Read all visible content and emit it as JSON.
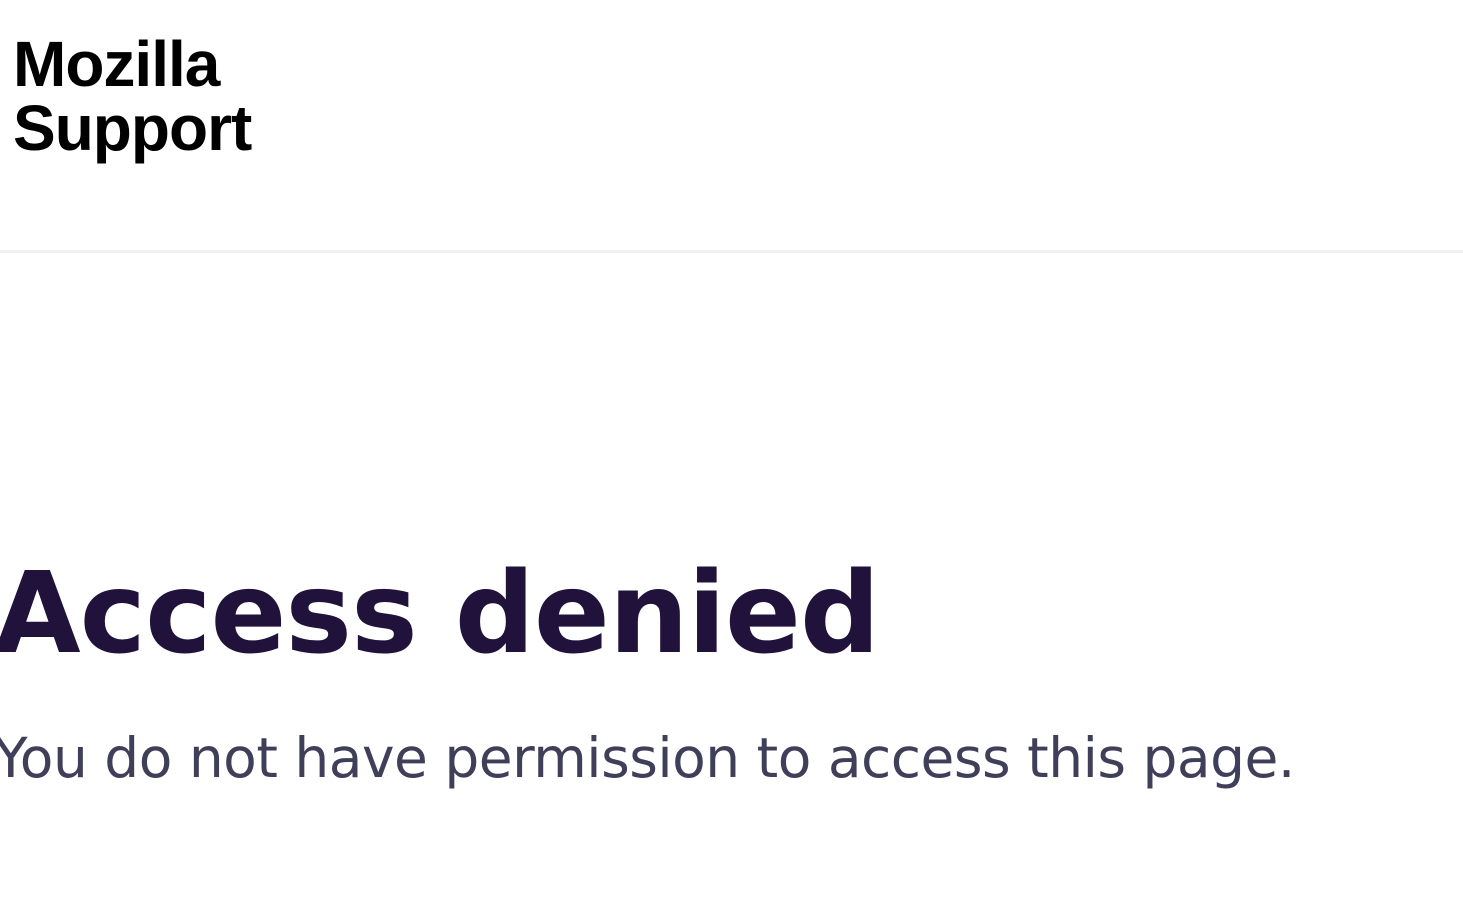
{
  "header": {
    "logo": {
      "line1": "Mozilla",
      "line2": "Support"
    }
  },
  "main": {
    "title": "Access denied",
    "message": "You do not have permission to access this page."
  },
  "colors": {
    "title": "#20123a",
    "message": "#3f3f5a",
    "logo": "#000000",
    "divider": "#f0f0f4",
    "background": "#ffffff"
  }
}
